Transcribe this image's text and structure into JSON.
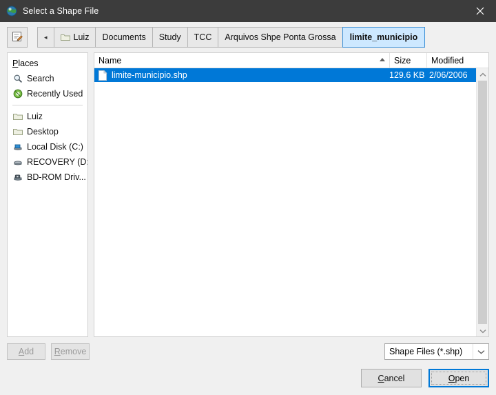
{
  "window": {
    "title": "Select a Shape File",
    "title_icon": "globe-icon",
    "close_icon": "close-icon",
    "titlebar_color": "#3c3c3c",
    "accent_color": "#0078d7"
  },
  "toolbar": {
    "edit_location_icon": "edit-location-icon",
    "back_label": "◂",
    "crumbs": [
      {
        "label": "Luiz",
        "icon": "folder-icon",
        "active": false
      },
      {
        "label": "Documents",
        "icon": "",
        "active": false
      },
      {
        "label": "Study",
        "icon": "",
        "active": false
      },
      {
        "label": "TCC",
        "icon": "",
        "active": false
      },
      {
        "label": "Arquivos Shpe Ponta Grossa",
        "icon": "",
        "active": false
      },
      {
        "label": "limite_municipio",
        "icon": "",
        "active": true
      }
    ]
  },
  "places": {
    "header_mnemonic": "P",
    "header_rest": "laces",
    "items": [
      {
        "label": "Search",
        "icon": "search-icon"
      },
      {
        "label": "Recently Used",
        "icon": "recently-used-icon"
      },
      {
        "separator": true
      },
      {
        "label": "Luiz",
        "icon": "folder-icon"
      },
      {
        "label": "Desktop",
        "icon": "folder-icon"
      },
      {
        "label": "Local Disk (C:)",
        "icon": "hard-drive-icon"
      },
      {
        "label": "RECOVERY (D:)",
        "icon": "hard-drive-icon"
      },
      {
        "label": "BD-ROM Driv...",
        "icon": "optical-drive-icon"
      }
    ]
  },
  "filelist": {
    "columns": [
      "Name",
      "Size",
      "Modified"
    ],
    "sort_column": "Name",
    "sort_direction": "ascending",
    "rows": [
      {
        "name": "limite-municipio.shp",
        "size": "129.6 KB",
        "modified": "2/06/2006",
        "icon": "file-icon",
        "selected": true
      }
    ],
    "scroll_up_icon": "chevron-up-icon",
    "scroll_down_icon": "chevron-down-icon"
  },
  "actions": {
    "add": {
      "mn": "A",
      "rest": "dd",
      "disabled": true
    },
    "remove": {
      "mn": "R",
      "rest": "emove",
      "disabled": true
    },
    "cancel": {
      "mn": "C",
      "rest": "ancel"
    },
    "open": {
      "mn": "O",
      "rest": "pen"
    }
  },
  "filetype": {
    "value": "Shape Files (*.shp)",
    "arrow_icon": "chevron-down-icon",
    "options": [
      "Shape Files (*.shp)"
    ]
  }
}
